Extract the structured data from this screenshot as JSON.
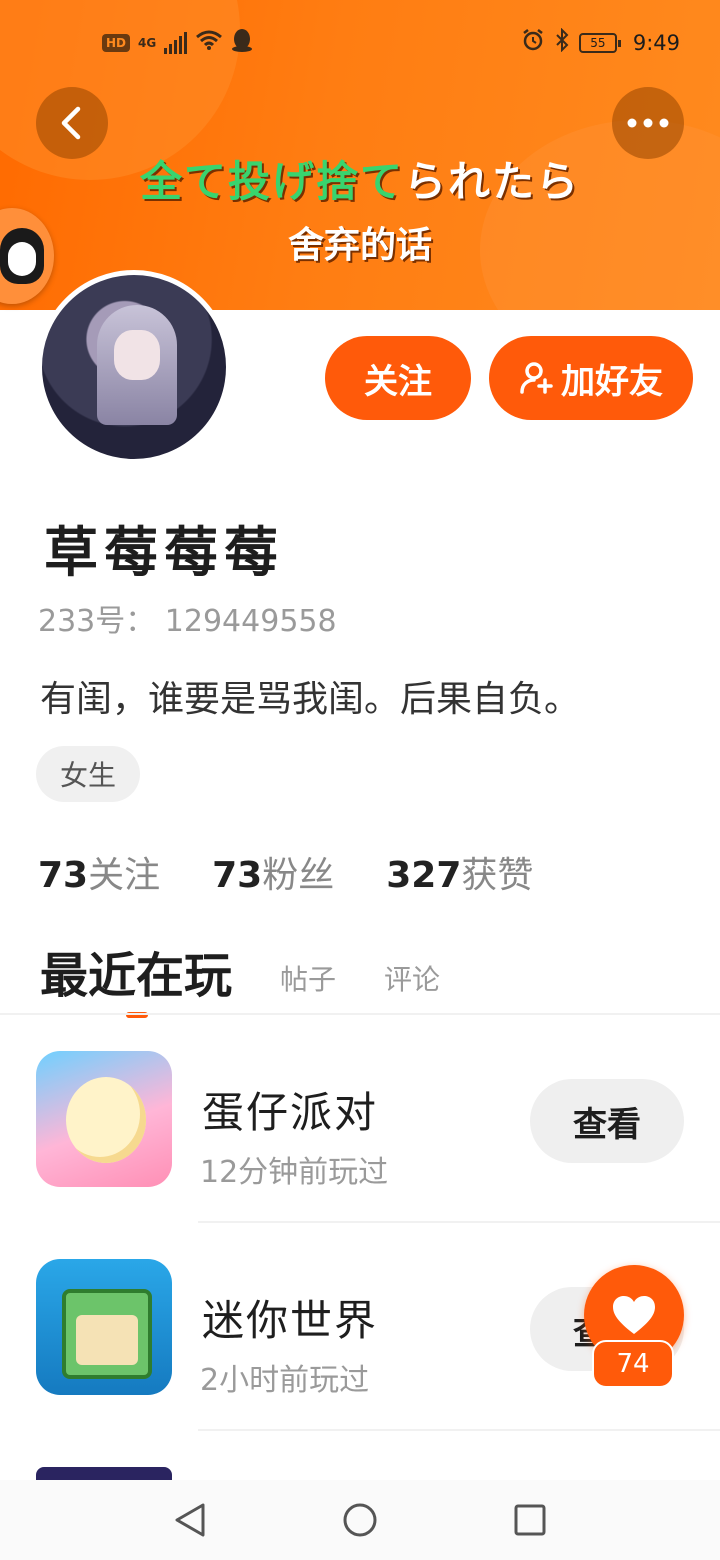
{
  "status_bar": {
    "hd": "HD",
    "network": "4G",
    "battery": "55",
    "time": "9:49",
    "icons": [
      "signal-icon",
      "wifi-icon",
      "qq-icon",
      "alarm-icon",
      "bluetooth-icon",
      "battery-icon"
    ]
  },
  "banner": {
    "caption_jp_green": "全て投げ捨て",
    "caption_jp_white": "られたら",
    "caption_cn": "舍弃的话",
    "colors": {
      "gradient_start": "#ff6a00",
      "gradient_end": "#ff8a1e",
      "caption_green": "#39d46e"
    }
  },
  "actions": {
    "follow_label": "关注",
    "add_friend_label": "加好友",
    "accent_color": "#ff5a0a"
  },
  "profile": {
    "username": "草莓莓莓",
    "uid": "233号： 129449558",
    "bio": "有闺，谁要是骂我闺。后果自负。",
    "gender_tag": "女生"
  },
  "stats": [
    {
      "value": "73",
      "label": "关注"
    },
    {
      "value": "73",
      "label": "粉丝"
    },
    {
      "value": "327",
      "label": "获赞"
    }
  ],
  "tabs": [
    {
      "label": "最近在玩",
      "active": true
    },
    {
      "label": "帖子",
      "active": false
    },
    {
      "label": "评论",
      "active": false
    }
  ],
  "games": [
    {
      "name": "蛋仔派对",
      "time": "12分钟前玩过",
      "button": "查看"
    },
    {
      "name": "迷你世界",
      "time": "2小时前玩过",
      "button": "查看"
    }
  ],
  "like_fab": {
    "count": "74"
  }
}
